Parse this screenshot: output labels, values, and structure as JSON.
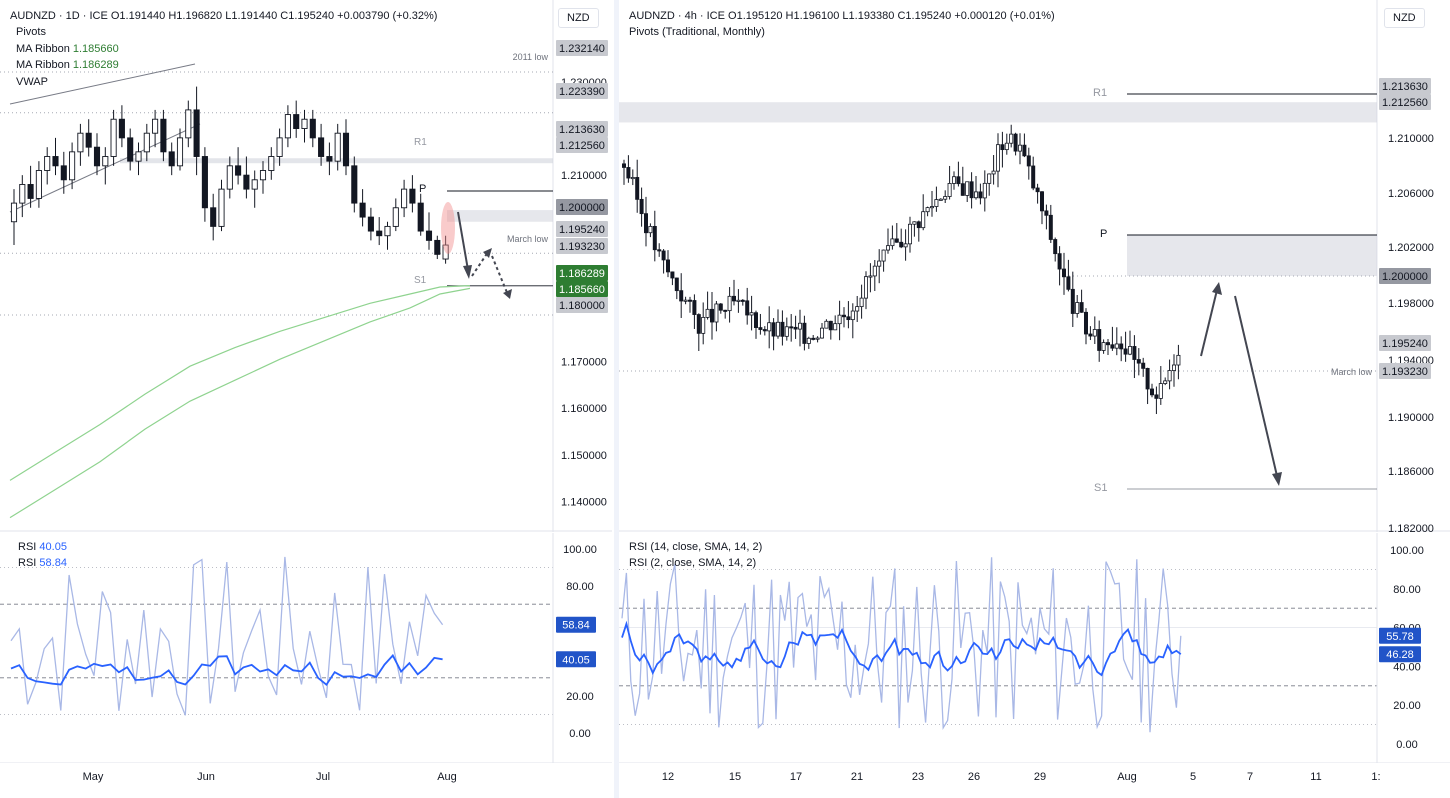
{
  "colors": {
    "up": "#131722",
    "down": "#131722",
    "grid": "#a6a9b3",
    "pivotZone": "#d1d4dc",
    "ma": "#8fd38f",
    "rsiMain": "#2962ff",
    "rsiFast": "#a9b8e6",
    "labelGrey": "#6f737d",
    "labelDark": "#c7c9cf",
    "greenLabel": "#2e7d32",
    "blueLabel": "#2154c8",
    "red": "#f28b8b"
  },
  "left": {
    "title": "AUDNZD · 1D · ICE",
    "ohlc": "O1.191440   H1.196820   L1.191440   C1.195240   +0.003790 (+0.32%)",
    "indicators": [
      "Pivots",
      "MA Ribbon",
      "MA Ribbon",
      "VWAP"
    ],
    "ma_values": [
      "1.185660",
      "1.186289"
    ],
    "currency": "NZD",
    "annotations": [
      "2011 low",
      "R1",
      "P",
      "March low",
      "S1"
    ],
    "price_ticks": [
      "1.230000",
      "1.220000",
      "1.210000",
      "1.190000",
      "1.170000",
      "1.160000",
      "1.150000",
      "1.140000"
    ],
    "price_labels": [
      "1.232140",
      "1.223390",
      "1.213630",
      "1.212560",
      "1.200000",
      "1.195240",
      "1.193230",
      "1.186289",
      "1.185660",
      "1.180000"
    ],
    "x_labels": [
      "May",
      "Jun",
      "Jul",
      "Aug"
    ],
    "rsi_title": "RSI",
    "rsi_values": [
      "40.05",
      "58.84"
    ],
    "rsi_ticks": [
      "100.00",
      "80.00",
      "20.00",
      "0.00"
    ]
  },
  "right": {
    "title": "AUDNZD · 4h · ICE",
    "ohlc": "O1.195120   H1.196100   L1.193380   C1.195240   +0.000120 (+0.01%)",
    "indicator": "Pivots (Traditional, Monthly)",
    "currency": "NZD",
    "annotations": [
      "R1",
      "P",
      "March low",
      "S1"
    ],
    "price_ticks": [
      "1.210000",
      "1.206000",
      "1.202000",
      "1.198000",
      "1.194000",
      "1.190000",
      "1.186000",
      "1.182000"
    ],
    "price_labels": [
      "1.213630",
      "1.212560",
      "1.200000",
      "1.195240",
      "1.193230"
    ],
    "x_labels": [
      "12",
      "15",
      "17",
      "21",
      "23",
      "26",
      "29",
      "Aug",
      "5",
      "7",
      "11",
      "1:"
    ],
    "rsi_line1": "RSI (14, close, SMA, 14, 2)",
    "rsi_line2": "RSI (2, close, SMA, 14, 2)",
    "rsi_values": [
      "55.78",
      "46.28"
    ],
    "rsi_ticks": [
      "100.00",
      "80.00",
      "60.00",
      "40.00",
      "20.00",
      "0.00"
    ]
  },
  "chart_data": [
    {
      "type": "candlestick",
      "title": "AUDNZD · 1D · ICE",
      "ylim": [
        1.136,
        1.239
      ],
      "levels": {
        "2011 low": 1.23214,
        "R1 upper": 1.21363,
        "R1": 1.21256,
        "P": 1.2,
        "March low": 1.19323,
        "S1": 1.18,
        "close": 1.19524
      },
      "ohlc": [
        [
          1.2,
          1.207,
          1.195,
          1.204
        ],
        [
          1.204,
          1.21,
          1.201,
          1.208
        ],
        [
          1.208,
          1.212,
          1.203,
          1.205
        ],
        [
          1.205,
          1.213,
          1.203,
          1.211
        ],
        [
          1.211,
          1.216,
          1.208,
          1.214
        ],
        [
          1.214,
          1.218,
          1.21,
          1.212
        ],
        [
          1.212,
          1.215,
          1.206,
          1.209
        ],
        [
          1.209,
          1.217,
          1.207,
          1.215
        ],
        [
          1.215,
          1.221,
          1.212,
          1.219
        ],
        [
          1.219,
          1.222,
          1.214,
          1.216
        ],
        [
          1.216,
          1.219,
          1.21,
          1.212
        ],
        [
          1.212,
          1.216,
          1.208,
          1.214
        ],
        [
          1.214,
          1.224,
          1.212,
          1.222
        ],
        [
          1.222,
          1.225,
          1.216,
          1.218
        ],
        [
          1.218,
          1.22,
          1.211,
          1.213
        ],
        [
          1.213,
          1.217,
          1.21,
          1.215
        ],
        [
          1.215,
          1.221,
          1.213,
          1.219
        ],
        [
          1.219,
          1.224,
          1.216,
          1.222
        ],
        [
          1.222,
          1.224,
          1.213,
          1.215
        ],
        [
          1.215,
          1.217,
          1.21,
          1.212
        ],
        [
          1.212,
          1.22,
          1.211,
          1.218
        ],
        [
          1.218,
          1.226,
          1.216,
          1.224
        ],
        [
          1.224,
          1.229,
          1.21,
          1.214
        ],
        [
          1.214,
          1.216,
          1.2,
          1.203
        ],
        [
          1.203,
          1.206,
          1.196,
          1.199
        ],
        [
          1.199,
          1.209,
          1.198,
          1.207
        ],
        [
          1.207,
          1.214,
          1.205,
          1.212
        ],
        [
          1.212,
          1.216,
          1.208,
          1.21
        ],
        [
          1.21,
          1.214,
          1.205,
          1.207
        ],
        [
          1.207,
          1.211,
          1.203,
          1.209
        ],
        [
          1.209,
          1.213,
          1.206,
          1.211
        ],
        [
          1.211,
          1.216,
          1.209,
          1.214
        ],
        [
          1.214,
          1.22,
          1.212,
          1.218
        ],
        [
          1.218,
          1.225,
          1.216,
          1.223
        ],
        [
          1.223,
          1.226,
          1.218,
          1.22
        ],
        [
          1.22,
          1.224,
          1.217,
          1.222
        ],
        [
          1.222,
          1.224,
          1.216,
          1.218
        ],
        [
          1.218,
          1.221,
          1.212,
          1.214
        ],
        [
          1.214,
          1.217,
          1.21,
          1.213
        ],
        [
          1.213,
          1.221,
          1.211,
          1.219
        ],
        [
          1.219,
          1.222,
          1.21,
          1.212
        ],
        [
          1.212,
          1.214,
          1.202,
          1.204
        ],
        [
          1.204,
          1.207,
          1.199,
          1.201
        ],
        [
          1.201,
          1.203,
          1.196,
          1.198
        ],
        [
          1.198,
          1.201,
          1.195,
          1.197
        ],
        [
          1.197,
          1.2,
          1.194,
          1.199
        ],
        [
          1.199,
          1.205,
          1.198,
          1.203
        ],
        [
          1.203,
          1.209,
          1.201,
          1.207
        ],
        [
          1.207,
          1.21,
          1.202,
          1.204
        ],
        [
          1.204,
          1.206,
          1.197,
          1.198
        ],
        [
          1.198,
          1.202,
          1.194,
          1.196
        ],
        [
          1.196,
          1.197,
          1.192,
          1.193
        ],
        [
          1.192,
          1.197,
          1.191,
          1.195
        ]
      ],
      "ma_ribbon": [
        [
          1.1445,
          1.1365
        ],
        [
          1.1505,
          1.1425
        ],
        [
          1.1565,
          1.1485
        ],
        [
          1.163,
          1.1555
        ],
        [
          1.169,
          1.1615
        ],
        [
          1.173,
          1.166
        ],
        [
          1.1765,
          1.1705
        ],
        [
          1.1795,
          1.1745
        ],
        [
          1.1825,
          1.1785
        ],
        [
          1.1845,
          1.1815
        ],
        [
          1.186,
          1.1845
        ],
        [
          1.1863,
          1.1857
        ]
      ]
    },
    {
      "type": "candlestick",
      "title": "AUDNZD · 4h · ICE",
      "ylim": [
        1.1815,
        1.2168
      ],
      "levels": {
        "R1 upper": 1.21363,
        "R1": 1.21256,
        "P": 1.20235,
        "zone low": 1.2,
        "March low": 1.19323,
        "S1": 1.1848,
        "close": 1.19524
      },
      "x_labels": [
        "12",
        "15",
        "17",
        "21",
        "23",
        "26",
        "29",
        "Aug",
        "5",
        "7",
        "11",
        "1:"
      ]
    },
    {
      "type": "line",
      "title": "RSI",
      "series": [
        {
          "name": "RSI",
          "value": 40.05
        },
        {
          "name": "RSI",
          "value": 58.84
        }
      ],
      "ylim": [
        0,
        100
      ],
      "levels": [
        90,
        70,
        30,
        10
      ]
    },
    {
      "type": "line",
      "title": "RSI (14, close, SMA, 14, 2)",
      "series": [
        {
          "name": "RSI (14, close, SMA, 14, 2)",
          "value": 46.28
        },
        {
          "name": "RSI (2, close, SMA, 14, 2)",
          "value": 55.78
        }
      ],
      "ylim": [
        0,
        100
      ],
      "levels": [
        90,
        70,
        30,
        10
      ]
    }
  ]
}
